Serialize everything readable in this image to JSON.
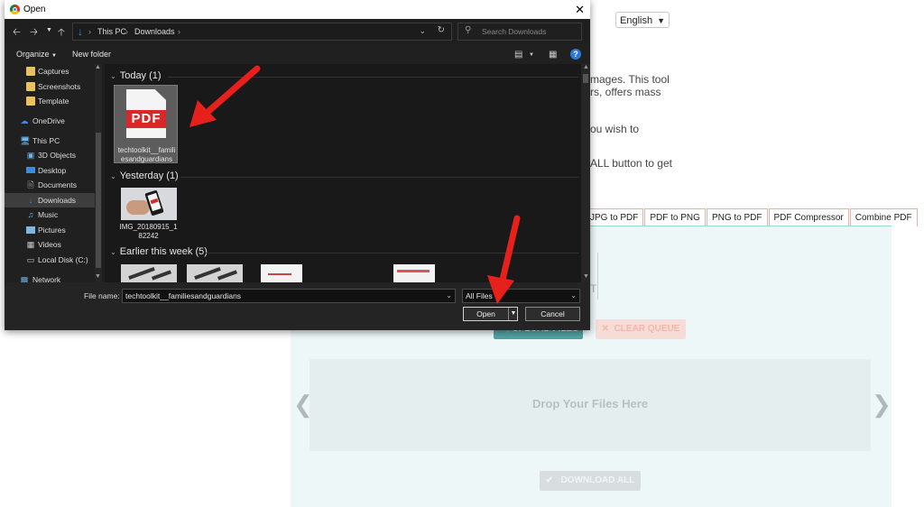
{
  "webpage": {
    "language": "English",
    "text_fragments": [
      "mages. This tool",
      "rs, offers mass",
      "ou wish to",
      "ALL button to get"
    ],
    "tabs": [
      "JPG to PDF",
      "PDF to PNG",
      "PNG to PDF",
      "PDF Compressor",
      "Combine PDF"
    ],
    "upload_label": "UPLOAD FILES",
    "clear_label": "CLEAR QUEUE",
    "drop_text": "Drop Your Files Here",
    "download_label": "DOWNLOAD ALL",
    "faint_chars": [
      "T"
    ]
  },
  "dialog": {
    "title": "Open",
    "breadcrumb": [
      "This PC",
      "Downloads"
    ],
    "search_placeholder": "Search Downloads",
    "organize": "Organize",
    "new_folder": "New folder",
    "nav_items": [
      {
        "label": "Captures",
        "icon": "folder-icon"
      },
      {
        "label": "Screenshots",
        "icon": "folder-icon"
      },
      {
        "label": "Template",
        "icon": "folder-icon"
      },
      {
        "label": "OneDrive",
        "icon": "cloud-icon"
      },
      {
        "label": "This PC",
        "icon": "computer-icon"
      },
      {
        "label": "3D Objects",
        "icon": "cube-icon"
      },
      {
        "label": "Desktop",
        "icon": "desktop-icon"
      },
      {
        "label": "Documents",
        "icon": "document-icon"
      },
      {
        "label": "Downloads",
        "icon": "download-icon"
      },
      {
        "label": "Music",
        "icon": "music-icon"
      },
      {
        "label": "Pictures",
        "icon": "picture-icon"
      },
      {
        "label": "Videos",
        "icon": "video-icon"
      },
      {
        "label": "Local Disk (C:)",
        "icon": "drive-icon"
      },
      {
        "label": "Network",
        "icon": "network-icon"
      }
    ],
    "groups": [
      {
        "label": "Today (1)"
      },
      {
        "label": "Yesterday (1)"
      },
      {
        "label": "Earlier this week (5)"
      }
    ],
    "files": {
      "pdf_name": "techtoolkit__familiesandguardians",
      "pdf_badge": "PDF",
      "img_name": "IMG_20180915_182242"
    },
    "file_name_label": "File name:",
    "file_name_value": "techtoolkit__familiesandguardians",
    "file_type": "All Files",
    "open_label": "Open",
    "cancel_label": "Cancel"
  },
  "colors": {
    "annotation_arrow": "#e8201c",
    "panel_bg": "#eef7f8",
    "upload_btn": "#53a4a2"
  }
}
